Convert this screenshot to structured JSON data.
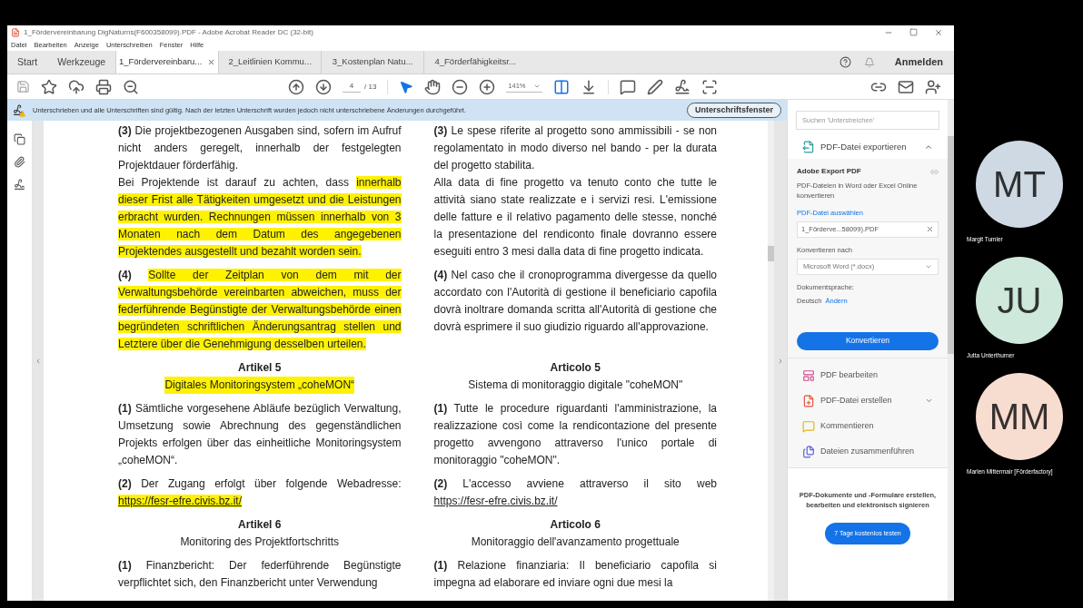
{
  "window": {
    "title": "1_Fördervereinbarung DigNaturns(F600358099).PDF - Adobe Acrobat Reader DC (32-bit)"
  },
  "menu": [
    {
      "label": "Datei"
    },
    {
      "label": "Bearbeiten"
    },
    {
      "label": "Anzeige"
    },
    {
      "label": "Unterschreiben"
    },
    {
      "label": "Fenster"
    },
    {
      "label": "Hilfe"
    }
  ],
  "tabs": [
    {
      "label": "Start",
      "kind": "nav",
      "selected": false
    },
    {
      "label": "Werkzeuge",
      "kind": "nav",
      "selected": false
    },
    {
      "label": "1_Fördervereinbaru...",
      "kind": "document",
      "selected": true
    },
    {
      "label": "2_Leitlinien Kommu...",
      "kind": "document",
      "selected": false
    },
    {
      "label": "3_Kostenplan Natu...",
      "kind": "document",
      "selected": false
    },
    {
      "label": "4_Förderfähigkeitsr...",
      "kind": "document",
      "selected": false
    }
  ],
  "sign_in": "Anmelden",
  "toolbar": {
    "page_current": "4",
    "page_total": "/ 13",
    "zoom": "141%"
  },
  "notification": {
    "text": "Unterschrieben und alle Unterschriften sind gültig. Nach der letzten Unterschrift wurden jedoch nicht unterschriebene Änderungen durchgeführt.",
    "button": "Unterschriftsfenster"
  },
  "document": {
    "rows": [
      {
        "kind": "paragraph",
        "de": [
          [
            {
              "text": "**(3)** Die projektbezogenen Ausgaben sind, sofern im Aufruf nicht anders geregelt, innerhalb der festgelegten Projektdauer förderfähig.",
              "highlighted": false
            }
          ],
          [
            {
              "text": "Bei Projektende ist darauf zu achten, dass ",
              "highlighted": false
            },
            {
              "text": "innerhalb dieser Frist alle Tätigkeiten umgesetzt und die Leistungen erbracht wurden. Rechnungen müssen innerhalb von 3 Monaten nach dem Datum des angegebenen Projektendes ausgestellt und bezahlt worden sein.",
              "highlighted": true
            }
          ]
        ],
        "it": [
          [
            {
              "text": "**(3)** Le spese riferite al progetto sono ammissibili - se non regolamentato in modo diverso nel bando - per la durata del progetto stabilita.",
              "highlighted": false
            }
          ],
          [
            {
              "text": "Alla data di fine progetto va tenuto conto che tutte le attività siano state realizzate e i servizi resi. L'emissione delle fatture e il relativo pagamento delle stesse, nonché la presentazione del rendiconto finale dovranno essere eseguiti entro 3 mesi dalla data di fine progetto indicata.",
              "highlighted": false
            }
          ]
        ]
      },
      {
        "kind": "paragraph",
        "de": [
          [
            {
              "text": "**(4)** ",
              "highlighted": false
            },
            {
              "text": "Sollte der Zeitplan von dem mit der Verwaltungsbehörde vereinbarten abweichen, muss der federführende Begünstigte der Verwaltungsbehörde einen begründeten schriftlichen Änderungsantrag stellen und Letztere über die Genehmigung desselben urteilen.",
              "highlighted": true
            }
          ]
        ],
        "it": [
          [
            {
              "text": "**(4)** Nel caso che il cronoprogramma divergesse da quello accordato con l'Autorità di gestione il beneficiario capofila dovrà inoltrare domanda scritta all'Autorità di gestione che dovrà esprimere il suo giudizio riguardo all'approvazione.",
              "highlighted": false
            }
          ]
        ]
      },
      {
        "kind": "heading",
        "de": {
          "title": "Artikel 5",
          "subtitle": "Digitales Monitoringsystem „coheMON“",
          "highlighted": true
        },
        "it": {
          "title": "Articolo 5",
          "subtitle": "Sistema di monitoraggio digitale \"coheMON\"",
          "highlighted": false
        }
      },
      {
        "kind": "paragraph",
        "de": [
          [
            {
              "text": "**(1)** Sämtliche vorgesehene Abläufe bezüglich Verwaltung, Umsetzung sowie Abrechnung des gegenständlichen Projekts erfolgen über das einheitliche Monitoringsystem „coheMON“.",
              "highlighted": false
            }
          ]
        ],
        "it": [
          [
            {
              "text": "**(1)** Tutte le procedure riguardanti l'amministrazione, la realizzazione così come la rendicontazione del presente progetto avvengono attraverso l'unico portale di monitoraggio \"coheMON\".",
              "highlighted": false
            }
          ]
        ]
      },
      {
        "kind": "paragraph",
        "de": [
          [
            {
              "text": "**(2)** Der Zugang erfolgt über folgende Webadresse: ",
              "highlighted": false
            },
            {
              "text": "https://fesr-efre.civis.bz.it/",
              "highlighted": true,
              "kind": "link"
            }
          ]
        ],
        "it": [
          [
            {
              "text": "**(2)** L'accesso avviene attraverso il sito web ",
              "highlighted": false
            },
            {
              "text": "https://fesr-efre.civis.bz.it/",
              "highlighted": false,
              "kind": "link"
            }
          ]
        ]
      },
      {
        "kind": "heading",
        "de": {
          "title": "Artikel 6",
          "subtitle": "Monitoring des Projektfortschritts",
          "highlighted": false
        },
        "it": {
          "title": "Articolo 6",
          "subtitle": "Monitoraggio dell'avanzamento progettuale",
          "highlighted": false
        }
      },
      {
        "kind": "paragraph",
        "de": [
          [
            {
              "text": "**(1)** Finanzbericht: Der federführende Begünstigte verpflichtet sich, den Finanzbericht unter Verwendung",
              "highlighted": false
            }
          ]
        ],
        "it": [
          [
            {
              "text": "**(1)** Relazione finanziaria: Il beneficiario capofila si impegna ad elaborare ed inviare ogni due mesi la",
              "highlighted": false
            }
          ]
        ]
      }
    ]
  },
  "right_pane": {
    "search_placeholder": "Suchen 'Unterstreichen'",
    "export": {
      "title": "PDF-Datei exportieren",
      "expanded": true,
      "heading": "Adobe Export PDF",
      "description": "PDF-Dateien in Word oder Excel Online konvertieren",
      "select_label": "PDF-Datei auswählen",
      "file": "1_Förderve...58099).PDF",
      "convert_label": "Konvertieren nach",
      "format": "Microsoft Word (*.docx)",
      "language_label": "Dokumentsprache:",
      "language": "Deutsch",
      "change": "Ändern",
      "button": "Konvertieren"
    },
    "tools": [
      {
        "label": "PDF bearbeiten",
        "kind": "edit",
        "expandable": false
      },
      {
        "label": "PDF-Datei erstellen",
        "kind": "create",
        "expandable": true
      },
      {
        "label": "Kommentieren",
        "kind": "comment",
        "expandable": false
      },
      {
        "label": "Dateien zusammenführen",
        "kind": "combine",
        "expandable": false
      }
    ],
    "promo": "PDF-Dokumente und -Formulare erstellen, bearbeiten und elektronisch signieren",
    "trial_button": "7 Tage kostenlos testen"
  },
  "participants": [
    {
      "initials": "MT",
      "name": "Margit Tumler",
      "color": "#cfd9e3"
    },
    {
      "initials": "JU",
      "name": "Jutta Unterthurner",
      "color": "#cfe8dc"
    },
    {
      "initials": "MM",
      "name": "Marlen Mittermair [Förderfactory]",
      "color": "#f7dcd0"
    }
  ]
}
